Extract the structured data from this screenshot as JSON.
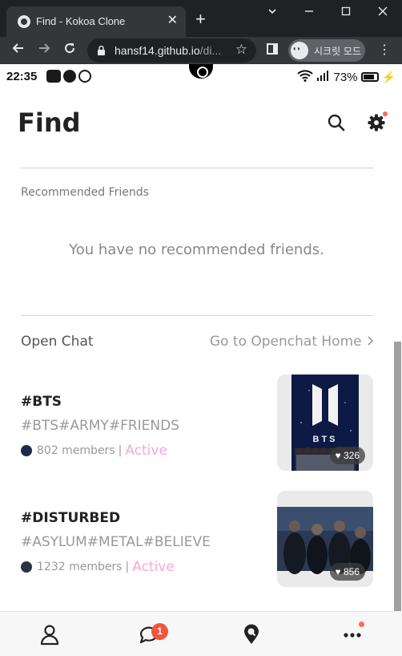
{
  "browser": {
    "tab_title": "Find - Kokoa Clone",
    "tab_close": "✕",
    "new_tab": "+",
    "url_host": "hansf14.github.io",
    "url_rest": "/di...",
    "incognito_label": "시크릿 모드"
  },
  "statusbar": {
    "time": "22:35",
    "battery": "73%"
  },
  "header": {
    "title": "Find"
  },
  "recommended": {
    "heading": "Recommended Friends",
    "empty_message": "You have no recommended friends."
  },
  "openchat": {
    "label": "Open Chat",
    "link": "Go to Openchat Home",
    "items": [
      {
        "name": "#BTS",
        "tags": "#BTS#ARMY#FRIENDS",
        "members": "802 members",
        "status": "Active",
        "likes": "326",
        "image_text": "BTS"
      },
      {
        "name": "#DISTURBED",
        "tags": "#ASYLUM#METAL#BELIEVE",
        "members": "1232 members",
        "status": "Active",
        "likes": "856"
      }
    ]
  },
  "bottom_nav": {
    "chat_badge": "1"
  },
  "colors": {
    "active": "#f8a7cf",
    "badge": "#f2543d",
    "dot": "#ff6a55"
  }
}
